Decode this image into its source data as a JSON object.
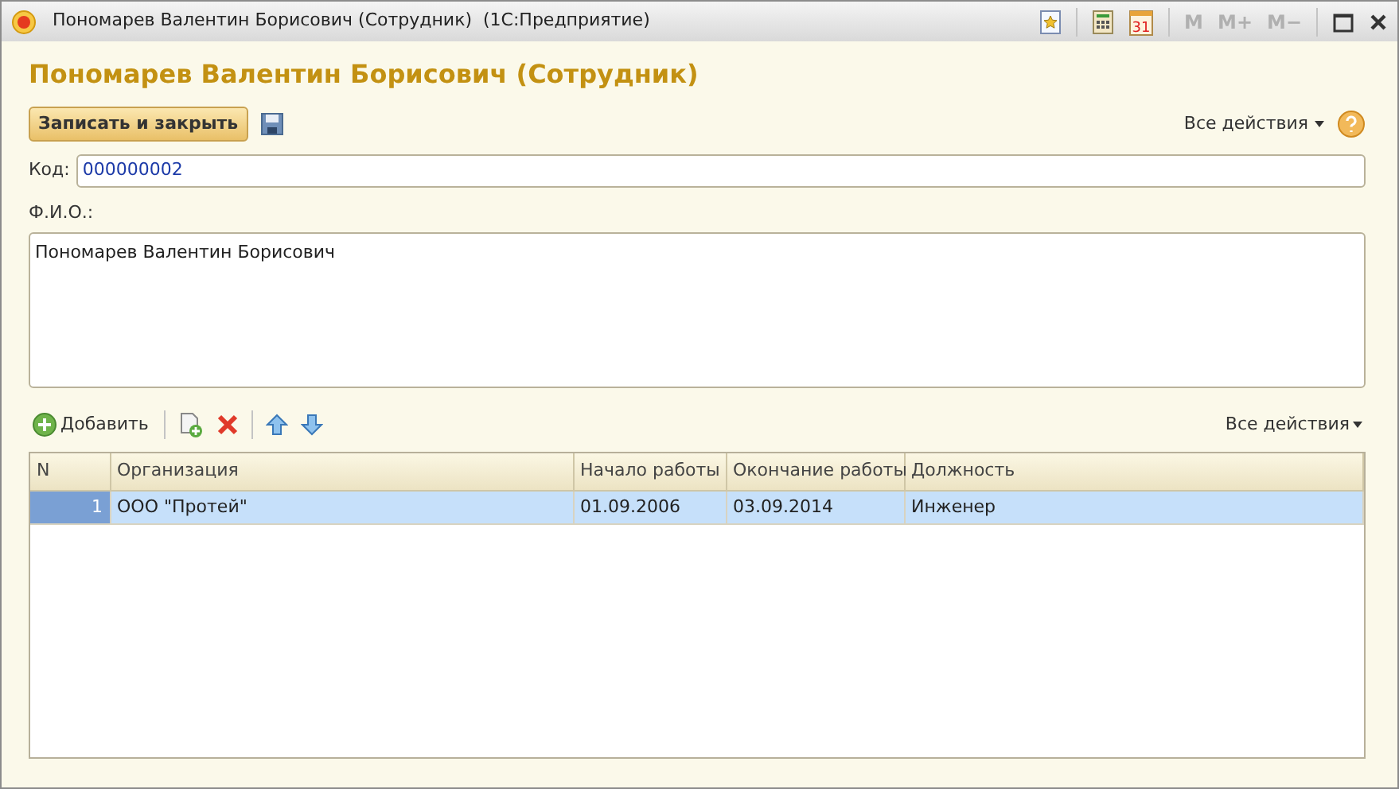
{
  "window": {
    "title": "Пономарев Валентин Борисович (Сотрудник)  (1С:Предприятие)",
    "calendar_day": "31",
    "memory_buttons": [
      {
        "label": "M",
        "disabled": true
      },
      {
        "label": "M+",
        "disabled": true
      },
      {
        "label": "M−",
        "disabled": true
      }
    ]
  },
  "form": {
    "heading": "Пономарев Валентин Борисович (Сотрудник)",
    "save_close_button": "Записать и закрыть",
    "all_actions": "Все действия",
    "code": {
      "label": "Код:",
      "value": "000000002"
    },
    "fio": {
      "label": "Ф.И.О.:",
      "value": "Пономарев Валентин Борисович"
    }
  },
  "table_toolbar": {
    "add_button": "Добавить",
    "all_actions": "Все действия"
  },
  "table": {
    "columns": [
      "N",
      "Организация",
      "Начало работы",
      "Окончание работы",
      "Должность"
    ],
    "rows": [
      {
        "cells": [
          "1",
          "ООО \"Протей\"",
          "01.09.2006",
          "03.09.2014",
          "Инженер"
        ],
        "selected": true
      }
    ]
  }
}
